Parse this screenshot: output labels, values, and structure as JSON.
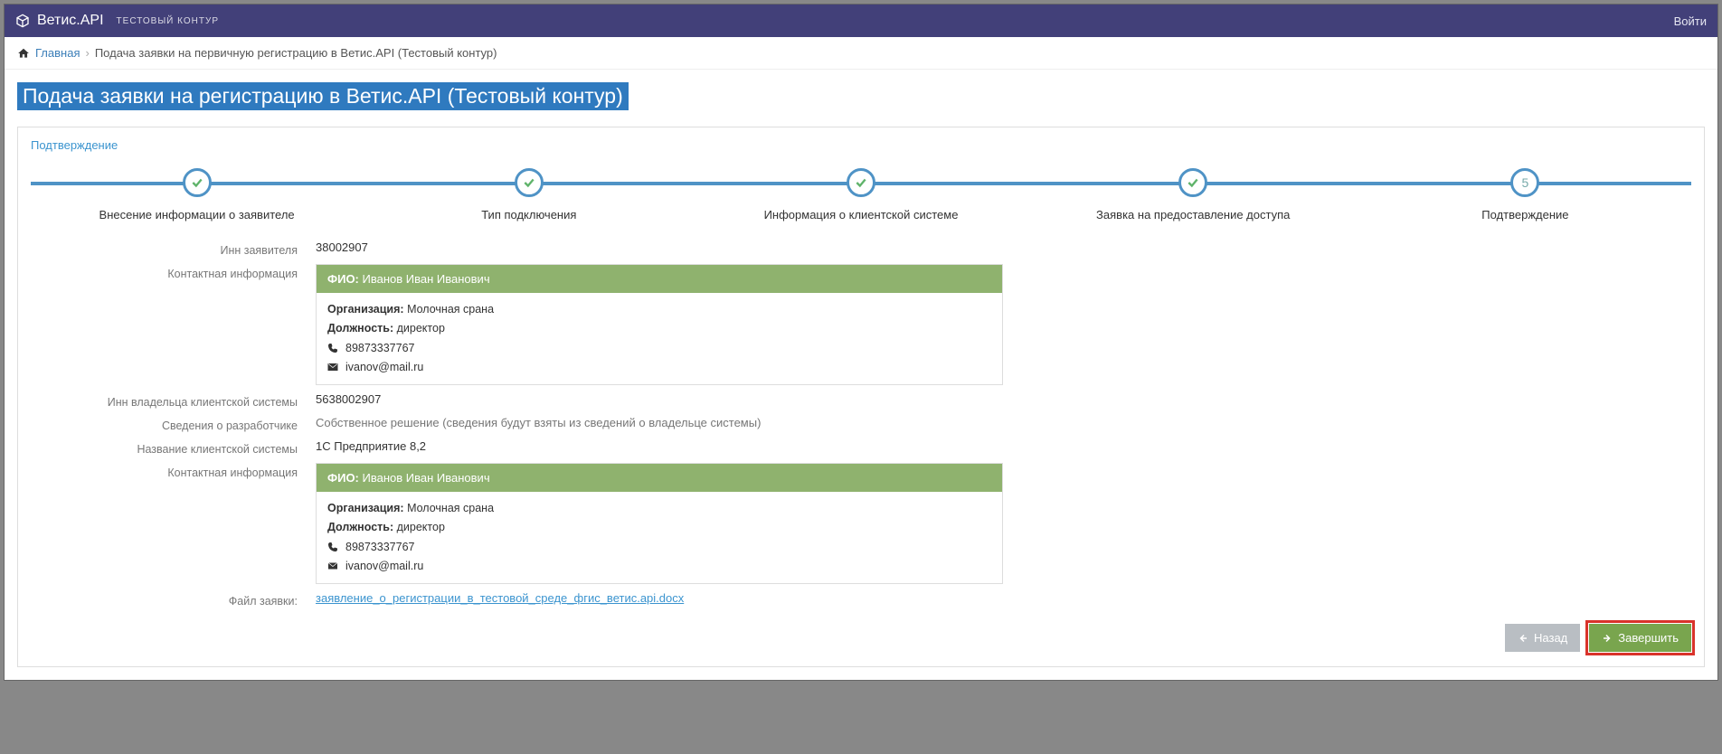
{
  "header": {
    "brand": "Ветис.API",
    "subtitle": "ТЕСТОВЫЙ КОНТУР",
    "login": "Войти"
  },
  "breadcrumb": {
    "home": "Главная",
    "current": "Подача заявки на первичную регистрацию в Ветис.API (Тестовый контур)"
  },
  "page_title": "Подача заявки на регистрацию в Ветис.API (Тестовый контур)",
  "panel_heading": "Подтверждение",
  "steps": [
    {
      "label": "Внесение информации о заявителе",
      "done": true
    },
    {
      "label": "Тип подключения",
      "done": true
    },
    {
      "label": "Информация о клиентской системе",
      "done": true
    },
    {
      "label": "Заявка на предоставление доступа",
      "done": true
    },
    {
      "label": "Подтверждение",
      "done": false,
      "num": "5"
    }
  ],
  "fields": {
    "inn_applicant_label": "Инн заявителя",
    "inn_applicant": "38002907",
    "contact1_label": "Контактная информация",
    "contact": {
      "fio_label": "ФИО:",
      "fio": "Иванов Иван Иванович",
      "org_label": "Организация:",
      "org": "Молочная срана",
      "pos_label": "Должность:",
      "pos": "директор",
      "phone": "89873337767",
      "email": "ivanov@mail.ru"
    },
    "inn_owner_label": "Инн владельца клиентской системы",
    "inn_owner": "5638002907",
    "dev_label": "Сведения о разработчике",
    "dev": "Собственное решение (сведения будут взяты из сведений о владельце системы)",
    "sysname_label": "Название клиентской системы",
    "sysname": "1С Предприятие 8,2",
    "contact2_label": "Контактная информация",
    "file_label": "Файл заявки:",
    "file": "заявление_о_регистрации_в_тестовой_среде_фгис_ветис.api.docx"
  },
  "buttons": {
    "back": "Назад",
    "finish": "Завершить"
  }
}
